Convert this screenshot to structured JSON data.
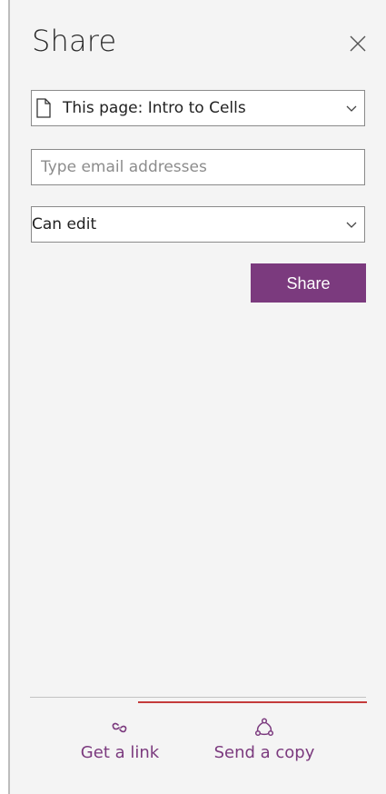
{
  "panel": {
    "title": "Share"
  },
  "scope_dropdown": {
    "selected": "This page: Intro to Cells"
  },
  "email": {
    "value": "",
    "placeholder": "Type email addresses"
  },
  "permission_dropdown": {
    "selected": "Can edit"
  },
  "share_button": {
    "label": "Share"
  },
  "bottom_actions": [
    {
      "label": "Get a link",
      "icon": "link-icon"
    },
    {
      "label": "Send a copy",
      "icon": "share-network-icon"
    }
  ],
  "colors": {
    "accent": "#7b3a7e",
    "panel_bg": "#f4f4f4",
    "highlight": "#c43b3b"
  }
}
